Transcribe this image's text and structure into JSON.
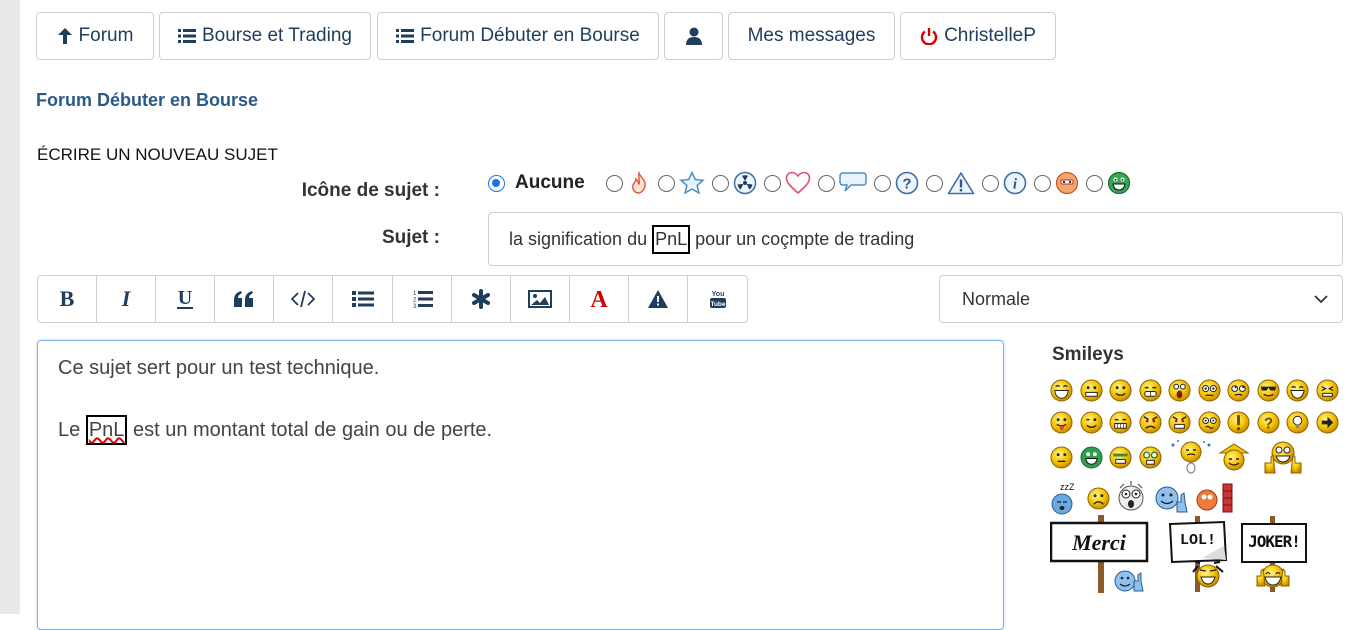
{
  "nav": {
    "forum": "Forum",
    "bourse": "Bourse et Trading",
    "debuter": "Forum Débuter en Bourse",
    "messages": "Mes messages",
    "user": "ChristelleP"
  },
  "page": {
    "forum_title": "Forum Débuter en Bourse",
    "section_title": "ÉCRIRE UN NOUVEAU SUJET"
  },
  "form": {
    "icon_label": "Icône de sujet :",
    "icon_none": "Aucune",
    "subject_label": "Sujet :",
    "subject_before": "la signification du ",
    "subject_highlight": "PnL",
    "subject_after": " pour un coçmpte de trading",
    "size_select": "Normale"
  },
  "editor": {
    "line1": "Ce sujet sert pour un test technique.",
    "line2_before": "Le ",
    "line2_highlight": "PnL",
    "line2_after": " est un montant total de gain ou de perte."
  },
  "smileys": {
    "title": "Smileys",
    "sign_merci": "Merci",
    "sign_lol": "LOL!",
    "sign_joker": "JOKER!"
  },
  "colors": {
    "nav_text": "#1f3d5c",
    "link_title": "#2a5a8a",
    "power_red": "#d40000",
    "radio_blue": "#1a73e8",
    "smiley_yellow": "#f5c400"
  },
  "icons": [
    "arrow-up-icon",
    "list-icon",
    "list-icon",
    "user-icon",
    "power-icon",
    "flame-icon",
    "star-icon",
    "radioactive-icon",
    "heart-icon",
    "speech-bubble-icon",
    "question-icon",
    "warning-icon",
    "info-icon",
    "angry-icon",
    "grin-icon"
  ]
}
